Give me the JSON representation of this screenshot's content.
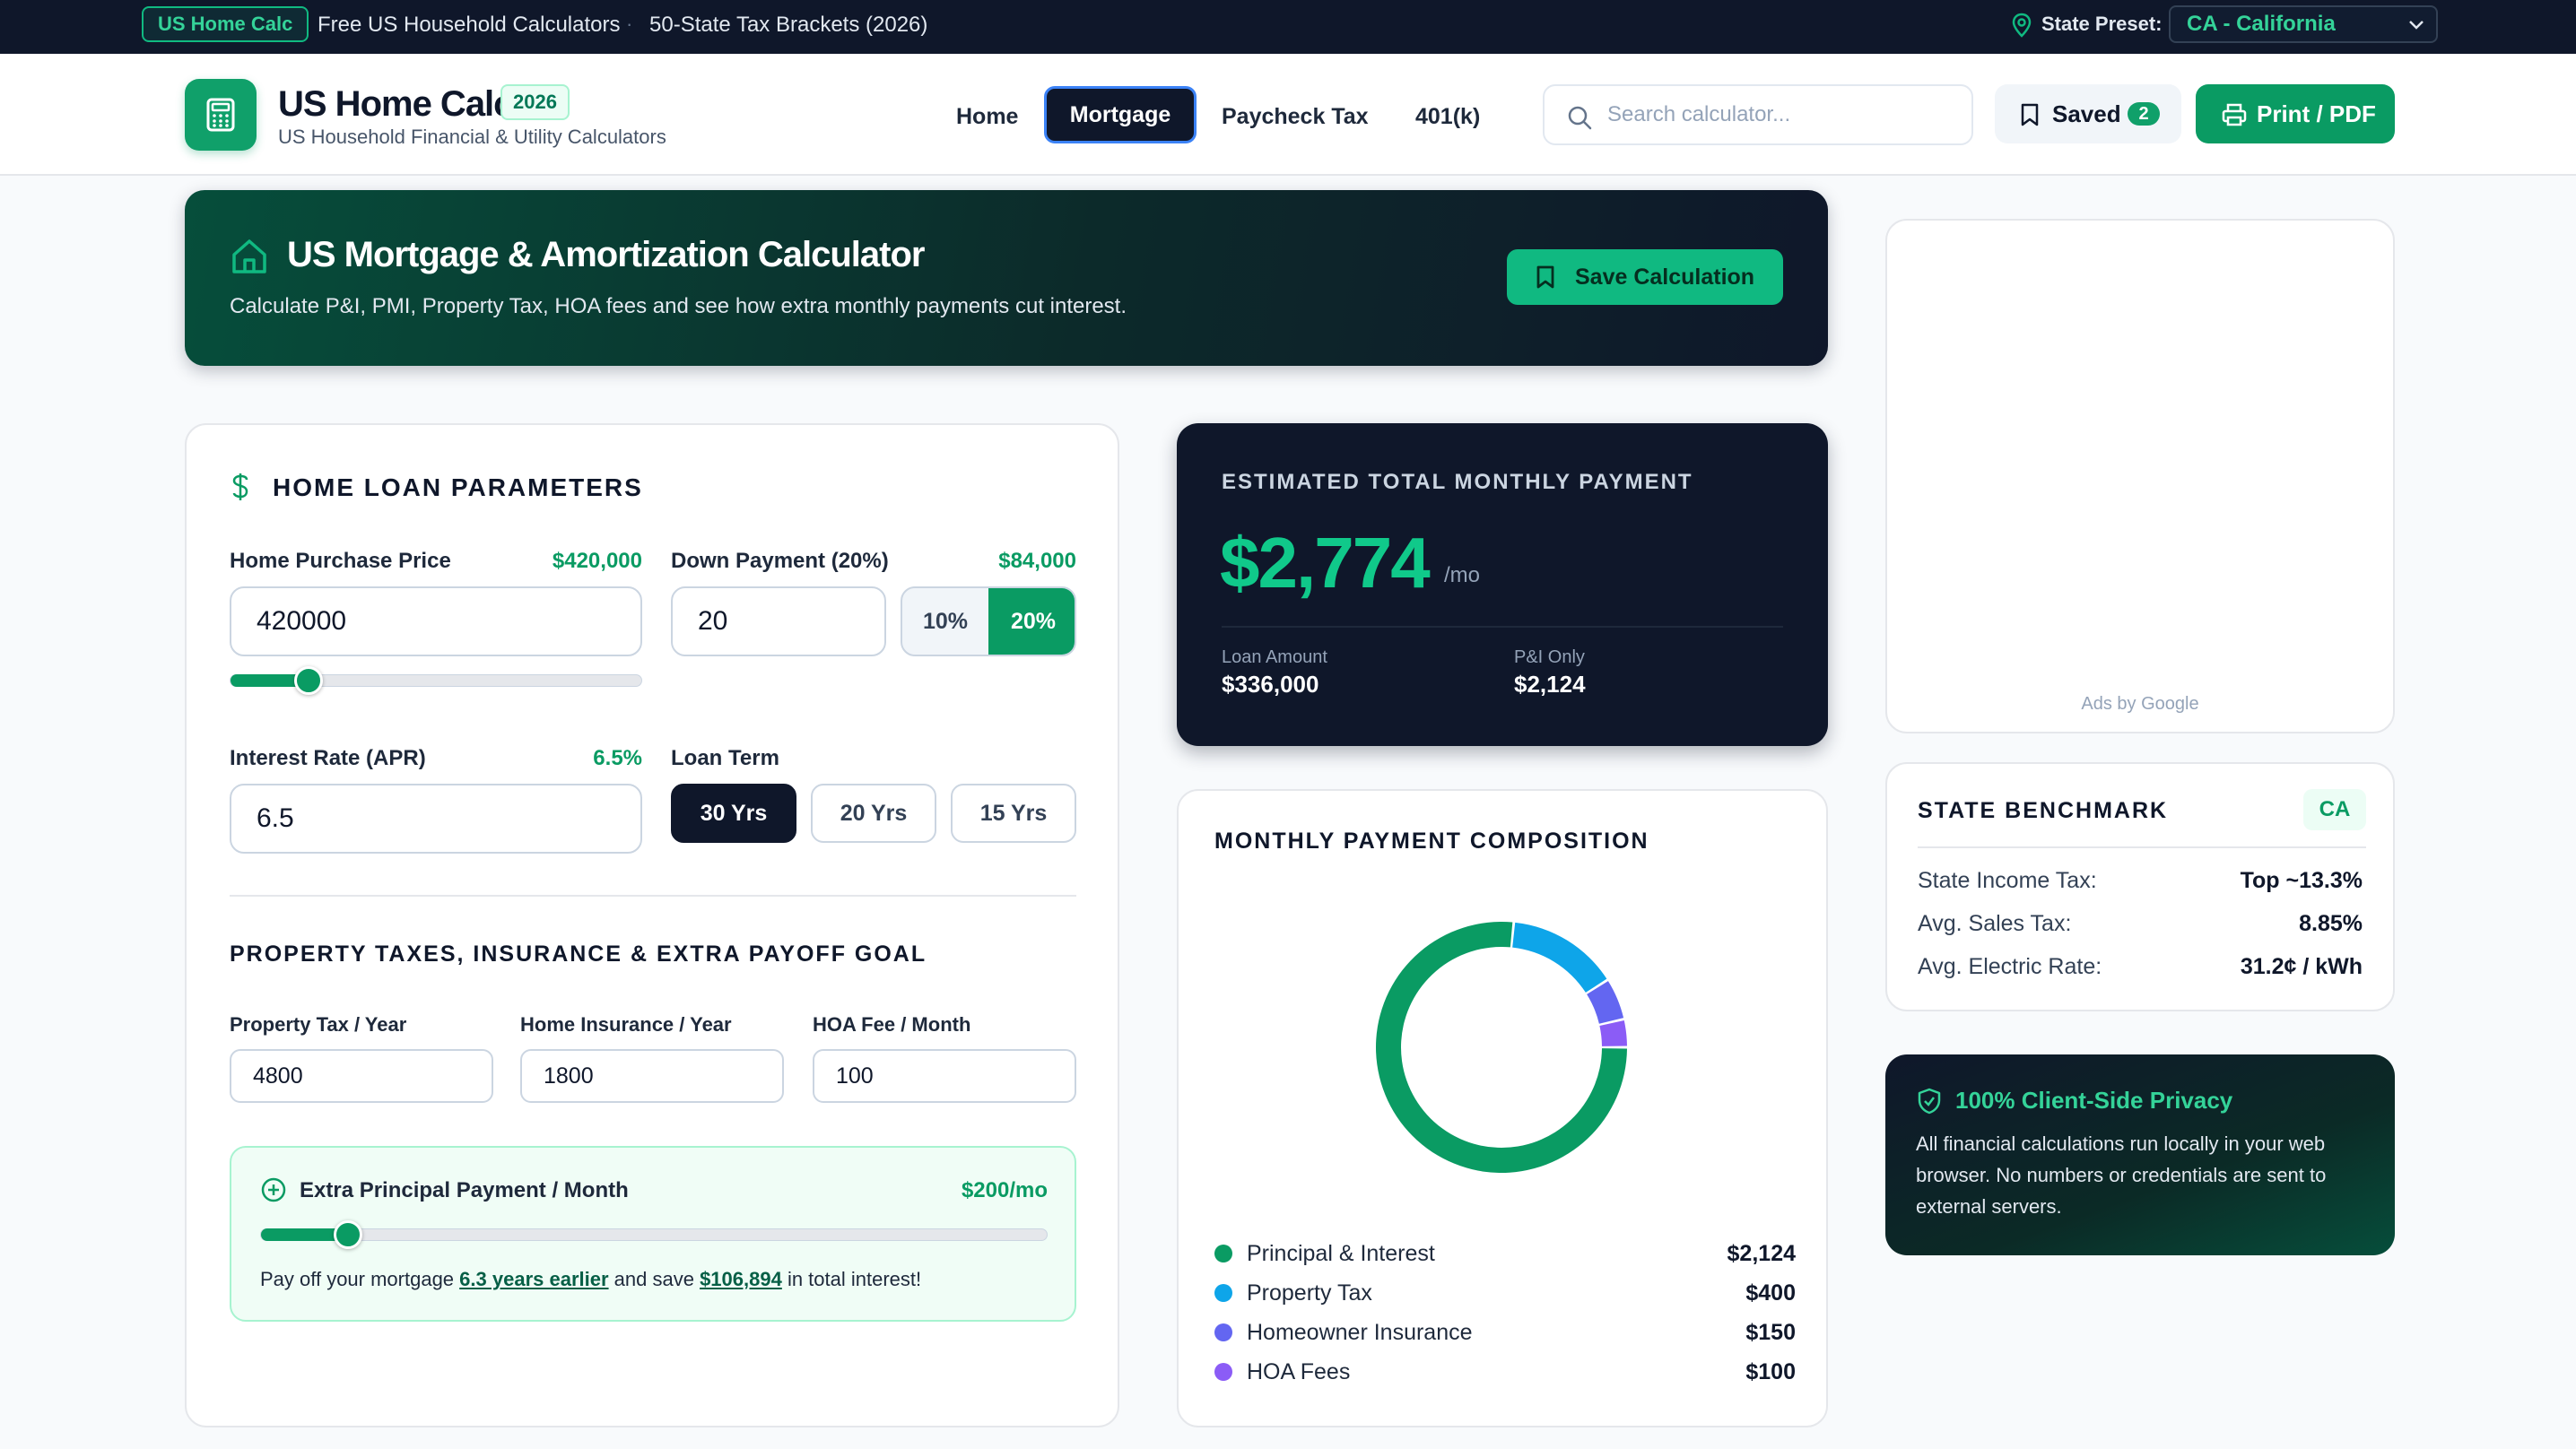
{
  "topbar": {
    "badge": "US Home Calc",
    "link_1": "Free US Household Calculators",
    "separator": "·",
    "link_2": "50-State Tax Brackets (2026)",
    "state_label": "State Preset:",
    "state_value": "CA - California"
  },
  "header": {
    "brand": "US Home Calc",
    "year": "2026",
    "subtitle": "US Household Financial & Utility Calculators",
    "nav": [
      "Home",
      "Mortgage",
      "Paycheck Tax",
      "401(k)"
    ],
    "active_nav": "Mortgage",
    "search_placeholder": "Search calculator...",
    "saved_label": "Saved",
    "saved_count": "2",
    "print_label": "Print / PDF"
  },
  "hero": {
    "title": "US Mortgage & Amortization Calculator",
    "subtitle": "Calculate P&I, PMI, Property Tax, HOA fees and see how extra monthly payments cut interest.",
    "save_label": "Save Calculation"
  },
  "params": {
    "section_title": "HOME LOAN PARAMETERS",
    "price": {
      "label": "Home Purchase Price",
      "display": "$420,000",
      "value": "420000",
      "slider_fraction": 0.19
    },
    "down": {
      "label": "Down Payment (20%)",
      "display": "$84,000",
      "value": "20",
      "options": [
        "10%",
        "20%"
      ],
      "selected": "20%"
    },
    "rate": {
      "label": "Interest Rate (APR)",
      "display": "6.5%",
      "value": "6.5"
    },
    "term": {
      "label": "Loan Term",
      "options": [
        "30 Yrs",
        "20 Yrs",
        "15 Yrs"
      ],
      "selected": "30 Yrs"
    },
    "section2_title": "PROPERTY TAXES, INSURANCE & EXTRA PAYOFF GOAL",
    "property_tax": {
      "label": "Property Tax / Year",
      "value": "4800"
    },
    "insurance": {
      "label": "Home Insurance / Year",
      "value": "1800"
    },
    "hoa": {
      "label": "HOA Fee / Month",
      "value": "100"
    },
    "extra": {
      "label": "Extra Principal Payment / Month",
      "display": "$200/mo",
      "slider_fraction": 0.11,
      "msg_prefix": "Pay off your mortgage ",
      "years": "6.3 years earlier",
      "msg_mid": " and save ",
      "savings": "$106,894",
      "msg_suffix": " in total interest!"
    }
  },
  "total": {
    "caption": "ESTIMATED TOTAL MONTHLY PAYMENT",
    "amount": "$2,774",
    "unit": "/mo",
    "loan_label": "Loan Amount",
    "loan_value": "$336,000",
    "pi_label": "P&I Only",
    "pi_value": "$2,124"
  },
  "composition": {
    "title": "MONTHLY PAYMENT COMPOSITION",
    "items": [
      {
        "name": "Principal & Interest",
        "amount": "$2,124",
        "value": 2124,
        "color": "#0a9b63"
      },
      {
        "name": "Property Tax",
        "amount": "$400",
        "value": 400,
        "color": "#0ea5e9"
      },
      {
        "name": "Homeowner Insurance",
        "amount": "$150",
        "value": 150,
        "color": "#6366f1"
      },
      {
        "name": "HOA Fees",
        "amount": "$100",
        "value": 100,
        "color": "#8b5cf6"
      }
    ]
  },
  "chart_data": {
    "type": "pie",
    "title": "MONTHLY PAYMENT COMPOSITION",
    "categories": [
      "Principal & Interest",
      "Property Tax",
      "Homeowner Insurance",
      "HOA Fees"
    ],
    "values": [
      2124,
      400,
      150,
      100
    ]
  },
  "ad": {
    "label": "Ads by Google"
  },
  "bench": {
    "title": "STATE BENCHMARK",
    "code": "CA",
    "rows": [
      {
        "k": "State Income Tax:",
        "v": "Top ~13.3%"
      },
      {
        "k": "Avg. Sales Tax:",
        "v": "8.85%"
      },
      {
        "k": "Avg. Electric Rate:",
        "v": "31.2¢ / kWh"
      }
    ]
  },
  "privacy": {
    "title": "100% Client-Side Privacy",
    "body": "All financial calculations run locally in your web browser. No numbers or credentials are sent to external servers."
  },
  "colors": {
    "brand": "#0a9b63",
    "dark": "#0f172a",
    "accent_light": "#10c98a"
  }
}
